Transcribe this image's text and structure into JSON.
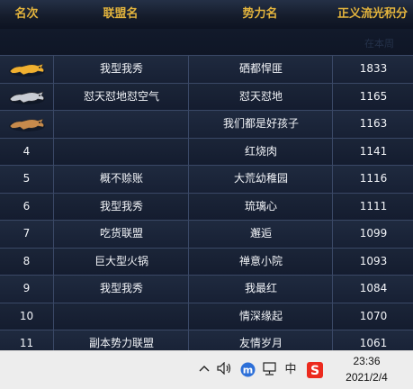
{
  "header": {
    "rank": "名次",
    "alliance": "联盟名",
    "faction": "势力名",
    "score": "正义流光积分"
  },
  "ghost_text": [
    "在本周",
    "在本周"
  ],
  "rows": [
    {
      "rank": "",
      "badge": "gold-beast-icon",
      "alliance": "我型我秀",
      "faction": "硒都悍匪",
      "score": "1833"
    },
    {
      "rank": "",
      "badge": "silver-beast-icon",
      "alliance": "怼天怼地怼空气",
      "faction": "怼天怼地",
      "score": "1165"
    },
    {
      "rank": "",
      "badge": "bronze-beast-icon",
      "alliance": "",
      "faction": "我们都是好孩子",
      "score": "1163"
    },
    {
      "rank": "4",
      "alliance": "",
      "faction": "红烧肉",
      "score": "1141"
    },
    {
      "rank": "5",
      "alliance": "概不赊账",
      "faction": "大荒幼稚园",
      "score": "1116"
    },
    {
      "rank": "6",
      "alliance": "我型我秀",
      "faction": "琉璃心",
      "score": "1111"
    },
    {
      "rank": "7",
      "alliance": "吃货联盟",
      "faction": "邂逅",
      "score": "1099"
    },
    {
      "rank": "8",
      "alliance": "巨大型火锅",
      "faction": "禅意小院",
      "score": "1093"
    },
    {
      "rank": "9",
      "alliance": "我型我秀",
      "faction": "我最红",
      "score": "1084"
    },
    {
      "rank": "10",
      "alliance": "",
      "faction": "情深缘起",
      "score": "1070"
    },
    {
      "rank": "11",
      "alliance": "副本势力联盟",
      "faction": "友情岁月",
      "score": "1061"
    }
  ],
  "taskbar": {
    "icons": [
      "chevron-up-icon",
      "volume-icon",
      "m-app-icon",
      "network-icon",
      "ime-zh-icon",
      "sogou-icon"
    ],
    "ime_label": "中",
    "time": "23:36",
    "date": "2021/2/4"
  },
  "colors": {
    "header_text": "#e3b43d",
    "row_text": "#f2f4f8",
    "gold": "#f0b030",
    "silver": "#c8ccd4",
    "bronze": "#c68a4c"
  }
}
